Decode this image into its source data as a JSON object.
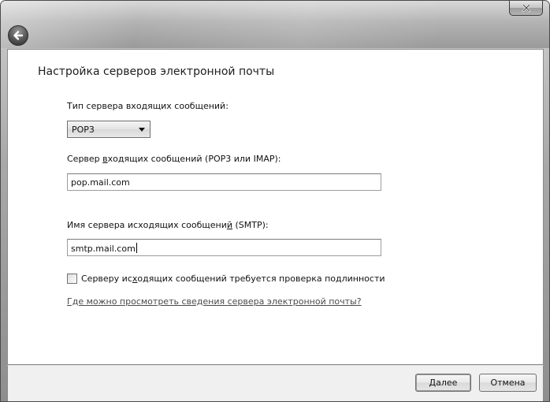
{
  "dialog": {
    "title": "Настройка серверов электронной почты"
  },
  "incoming_type": {
    "label": "Тип сервера входящих сообщений:",
    "selected": "POP3"
  },
  "incoming_server": {
    "label_pre": "Сервер ",
    "label_underlined": "в",
    "label_post": "ходящих сообщений (POP3 или IMAP):",
    "value": "pop.mail.com"
  },
  "outgoing_server": {
    "label_pre": "Имя сервера исходящих сообщени",
    "label_underlined": "й",
    "label_post": " (SMTP):",
    "value": "smtp.mail.com"
  },
  "auth_checkbox": {
    "label_pre": "Серверу ис",
    "label_underlined": "х",
    "label_post": "одящих сообщений требуется проверка подлинности",
    "checked": false
  },
  "help_link": {
    "text": "Где можно просмотреть сведения сервера электронной почты?"
  },
  "footer": {
    "next_label": "Далее",
    "cancel_label": "Отмена"
  },
  "icons": {
    "close": "close-icon",
    "back": "back-arrow-icon"
  }
}
